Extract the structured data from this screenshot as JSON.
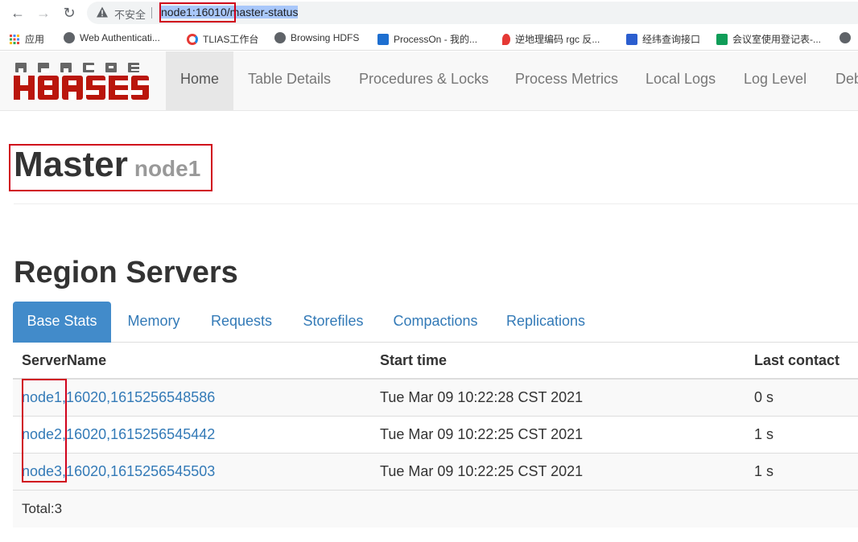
{
  "browser": {
    "security_label": "不安全",
    "url_host": "node1:16010",
    "url_sep": "/",
    "url_path": "master-status"
  },
  "bookmarks": [
    {
      "label": "应用",
      "color": "#4285f4"
    },
    {
      "label": "Web Authenticati...",
      "color": "#5f6368"
    },
    {
      "label": "TLIAS工作台",
      "color": "#e53935"
    },
    {
      "label": "Browsing HDFS",
      "color": "#5f6368"
    },
    {
      "label": "ProcessOn - 我的...",
      "color": "#1e6fd0"
    },
    {
      "label": "逆地理编码 rgc 反...",
      "color": "#e53935"
    },
    {
      "label": "经纬查询接口",
      "color": "#2b5ecf"
    },
    {
      "label": "会议室使用登记表-...",
      "color": "#0f9d58"
    }
  ],
  "navbar": {
    "links": [
      "Home",
      "Table Details",
      "Procedures & Locks",
      "Process Metrics",
      "Local Logs",
      "Log Level",
      "Deb"
    ]
  },
  "page": {
    "title": "Master",
    "subtitle": "node1",
    "section_title": "Region Servers"
  },
  "tabs": [
    "Base Stats",
    "Memory",
    "Requests",
    "Storefiles",
    "Compactions",
    "Replications"
  ],
  "table": {
    "headers": [
      "ServerName",
      "Start time",
      "Last contact"
    ],
    "rows": [
      {
        "server": "node1,16020,1615256548586",
        "start": "Tue Mar 09 10:22:28 CST 2021",
        "contact": "0 s"
      },
      {
        "server": "node2,16020,1615256545442",
        "start": "Tue Mar 09 10:22:25 CST 2021",
        "contact": "1 s"
      },
      {
        "server": "node3,16020,1615256545503",
        "start": "Tue Mar 09 10:22:25 CST 2021",
        "contact": "1 s"
      }
    ],
    "total": "Total:3"
  },
  "colors": {
    "accent": "#428bca",
    "link": "#337ab7",
    "annotation": "#d0021b"
  }
}
